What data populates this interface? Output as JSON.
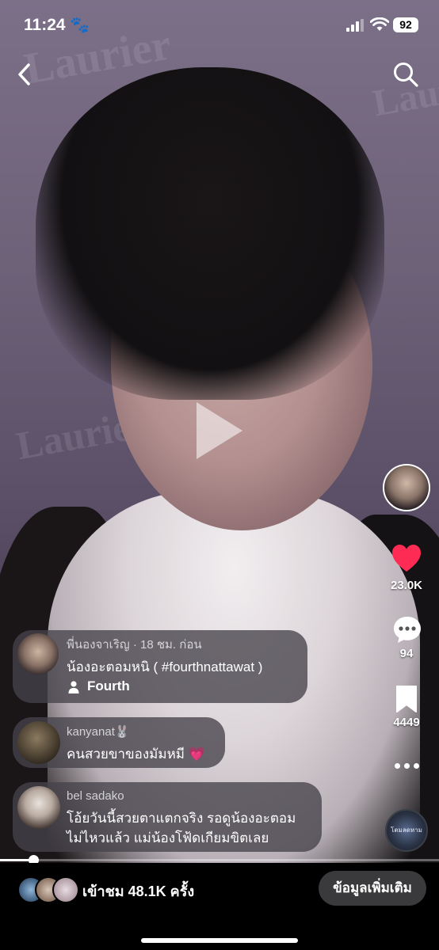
{
  "status_bar": {
    "time": "11:24",
    "battery": "92"
  },
  "video": {
    "watermark": "Laurier"
  },
  "actions": {
    "likes": "23.0K",
    "comments": "94",
    "saves": "4449",
    "like_color": "#fe2c55"
  },
  "music": {
    "label": "โตมลดหาม"
  },
  "post": {
    "user": "พี่นองจาเริญ · 18 ชม. ก่อน",
    "caption": "น้องอะตอมหนิ ( #fourthnattawat )",
    "tag": "Fourth"
  },
  "comments": [
    {
      "user": "kanyanat🐰",
      "text": "คนสวยขาของมัมหมี 💗"
    },
    {
      "user": "bel sadako",
      "text_line1": "โอ้ยวันนี้สวยตาแตกจริง รอดูน้องอะตอม",
      "text_line2": "ไม่ไหวแล้ว แม่น้องโฟ้ดเกียมขิตเลย"
    }
  ],
  "progress": {
    "fraction": 0.075
  },
  "bottom": {
    "views": "เข้าชม 48.1K ครั้ง",
    "more_info": "ข้อมูลเพิ่มเติม"
  }
}
